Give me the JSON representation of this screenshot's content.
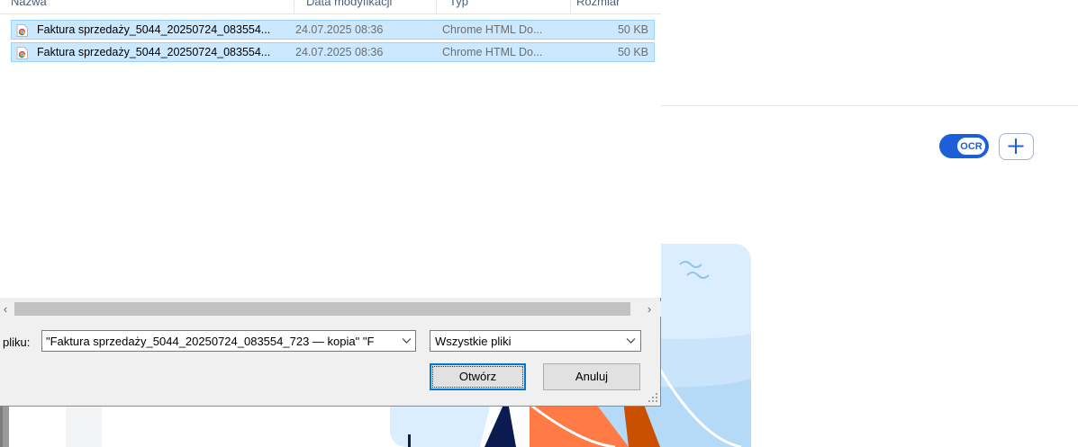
{
  "dialog": {
    "columns": {
      "name": "Nazwa",
      "modified": "Data modyfikacji",
      "type": "Typ",
      "size": "Rozmiar"
    },
    "files": [
      {
        "icon": "chrome-html-file-icon",
        "name": "Faktura sprzedaży_5044_20250724_083554...",
        "modified": "24.07.2025 08:36",
        "type": "Chrome HTML Do...",
        "size": "50 KB",
        "selected": true
      },
      {
        "icon": "chrome-html-file-icon",
        "name": "Faktura sprzedaży_5044_20250724_083554...",
        "modified": "24.07.2025 08:36",
        "type": "Chrome HTML Do...",
        "size": "50 KB",
        "selected": true
      }
    ],
    "filename_label": "pliku:",
    "filename_value": "\"Faktura sprzedaży_5044_20250724_083554_723 — kopia\" \"F",
    "filter_value": "Wszystkie pliki",
    "open_label": "Otwórz",
    "cancel_label": "Anuluj"
  },
  "background": {
    "ocr_label": "OCR",
    "accent_color": "#1d5fd6",
    "add_icon": "plus-icon"
  }
}
